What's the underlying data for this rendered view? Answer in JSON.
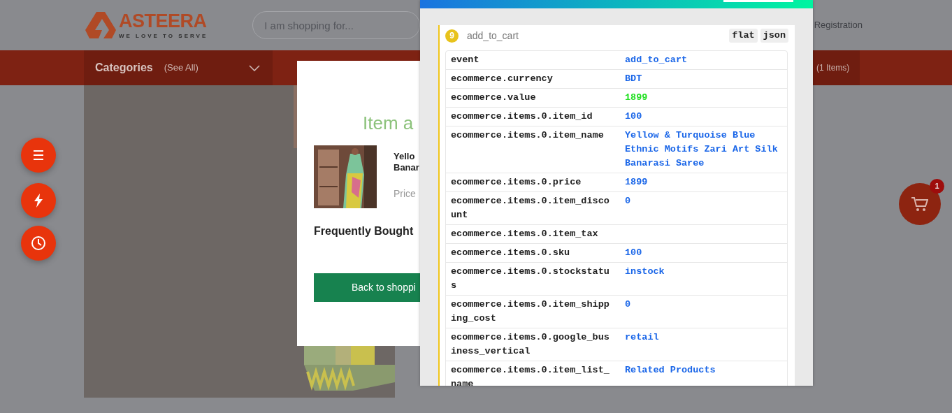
{
  "header": {
    "logo": {
      "name": "ASTEERA",
      "tagline": "WE LOVE TO SERVE"
    },
    "search": {
      "placeholder": "I am shopping for..."
    },
    "registration": "Registration"
  },
  "nav": {
    "categories": "Categories",
    "see_all": "(See All)",
    "cart_items": "(1 Items)"
  },
  "floating_buttons": [
    {
      "kind": "menu"
    },
    {
      "kind": "flash"
    },
    {
      "kind": "history"
    }
  ],
  "cart_button": {
    "badge": "1"
  },
  "modal": {
    "title": "Item a",
    "product_name_lines": [
      "Yello",
      "Banar"
    ],
    "price_label": "Price",
    "section_title": "Frequently Bought",
    "button": "Back to shoppi"
  },
  "debug_panel": {
    "event_number": "9",
    "event_name": "add_to_cart",
    "view_buttons": [
      "flat",
      "json"
    ],
    "rows": [
      {
        "key": "event",
        "value": "add_to_cart",
        "color": "#1a66e8"
      },
      {
        "key": "ecommerce.currency",
        "value": "BDT",
        "color": "#1a66e8"
      },
      {
        "key": "ecommerce.value",
        "value": "1899",
        "color": "#22e022"
      },
      {
        "key": "ecommerce.items.0.item_id",
        "value": "100",
        "color": "#1a66e8"
      },
      {
        "key": "ecommerce.items.0.item_name",
        "value": "Yellow & Turquoise Blue Ethnic Motifs Zari Art Silk Banarasi Saree",
        "color": "#1a66e8"
      },
      {
        "key": "ecommerce.items.0.price",
        "value": "1899",
        "color": "#1a66e8"
      },
      {
        "key": "ecommerce.items.0.item_discount",
        "value": "0",
        "color": "#1a66e8"
      },
      {
        "key": "ecommerce.items.0.item_tax"
      },
      {
        "key": "ecommerce.items.0.sku",
        "value": "100",
        "color": "#1a66e8"
      },
      {
        "key": "ecommerce.items.0.stockstatus",
        "value": "instock",
        "color": "#1a66e8"
      },
      {
        "key": "ecommerce.items.0.item_shipping_cost",
        "value": "0",
        "color": "#1a66e8"
      },
      {
        "key": "ecommerce.items.0.google_business_vertical",
        "value": "retail",
        "color": "#1a66e8"
      },
      {
        "key": "ecommerce.items.0.item_list_name",
        "value": "Related Products",
        "color": "#1a66e8"
      }
    ]
  }
}
